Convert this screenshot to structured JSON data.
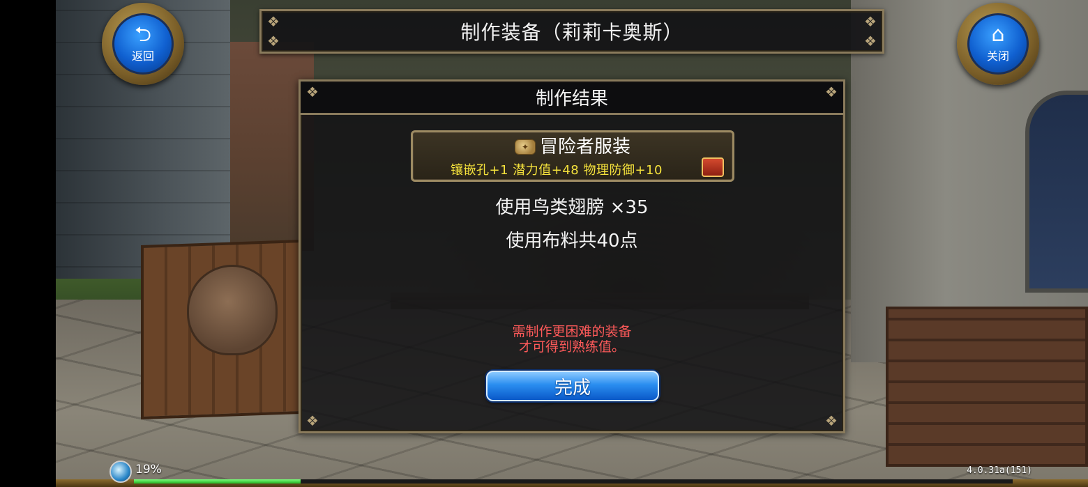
{
  "header": {
    "title": "制作装备（莉莉卡奥斯）",
    "back_button": {
      "label": "返回",
      "icon": "return-arrow-icon"
    },
    "close_button": {
      "label": "关闭",
      "icon": "home-icon"
    }
  },
  "result_dialog": {
    "title": "制作结果",
    "item": {
      "name": "冒险者服装",
      "stats": "镶嵌孔+1 潜力值+48 物理防御+10",
      "icon": "cloth-item-icon",
      "badge_icon": "treasure-chest-icon"
    },
    "materials": [
      "使用鸟类翅膀 ×35",
      "使用布料共40点"
    ],
    "note_lines": [
      "需制作更困难的装备",
      "才可得到熟练值。"
    ],
    "confirm_label": "完成"
  },
  "status": {
    "exp_percent": "19%",
    "exp_fraction": 0.19,
    "version": "4.0.31a(151)"
  },
  "colors": {
    "stat_yellow": "#f5e23c",
    "note_red": "#ff5a5a",
    "button_blue": "#2a8ef0",
    "frame_gold": "#8a7b5c"
  }
}
